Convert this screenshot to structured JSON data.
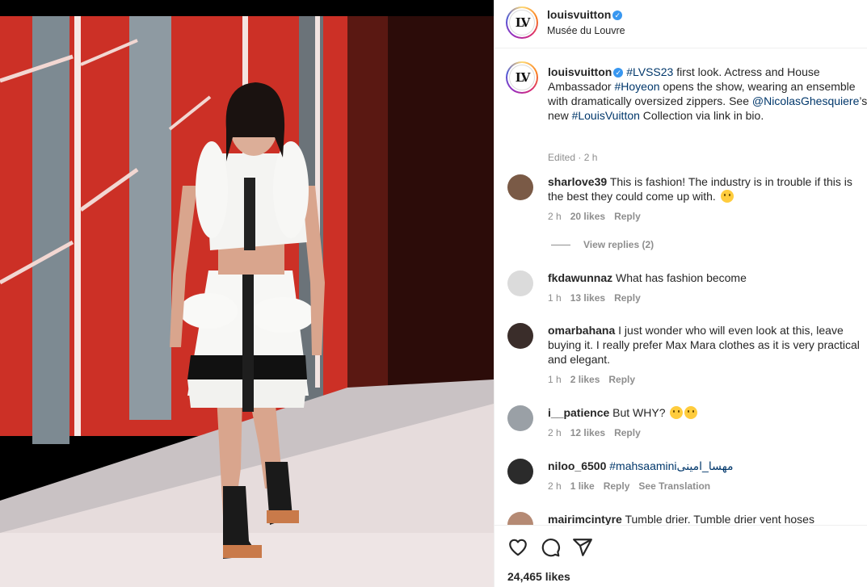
{
  "post": {
    "username": "louisvuitton",
    "location": "Musée du Louvre",
    "avatar_text": "LV"
  },
  "caption": {
    "username": "louisvuitton",
    "tag1": "#LVSS23",
    "text1": " first look. Actress and House Ambassador ",
    "tag2": "#Hoyeon",
    "text2": " opens the show, wearing an ensemble with dramatically oversized zippers. See ",
    "mention": "@NicolasGhesquiere",
    "text3": "’s new ",
    "tag3": "#LouisVuitton",
    "text4": " Collection via link in bio.",
    "meta": "Edited · 2 h"
  },
  "comments": [
    {
      "user": "sharlove39",
      "text": "This is fashion! The industry is in trouble if this is the best they could come up with.",
      "emoji": "weary-face",
      "time": "2 h",
      "likes": "20 likes",
      "reply": "Reply"
    },
    {
      "user": "fkdawunnaz",
      "text": "What has fashion become",
      "time": "1 h",
      "likes": "13 likes",
      "reply": "Reply"
    },
    {
      "user": "omarbahana",
      "text": "I just wonder who will even look at this, leave buying it. I really prefer Max Mara clothes as it is very practical and elegant.",
      "time": "1 h",
      "likes": "2 likes",
      "reply": "Reply"
    },
    {
      "user": "i__patience",
      "text": "But WHY?",
      "emoji": "confused-thinking",
      "time": "2 h",
      "likes": "12 likes",
      "reply": "Reply"
    },
    {
      "user": "niloo_6500",
      "tag": "#mahsaamini",
      "arabic": "مهسا_امینی",
      "time": "2 h",
      "likes": "1 like",
      "reply": "Reply",
      "translate": "See Translation"
    },
    {
      "user": "mairimcintyre",
      "text": "Tumble drier. Tumble drier vent hoses"
    }
  ],
  "view_replies": "View replies (2)",
  "footer": {
    "likes": "24,465 likes"
  },
  "colors": {
    "link": "#00376b",
    "muted": "#8e8e8e",
    "verified": "#3897f0"
  }
}
